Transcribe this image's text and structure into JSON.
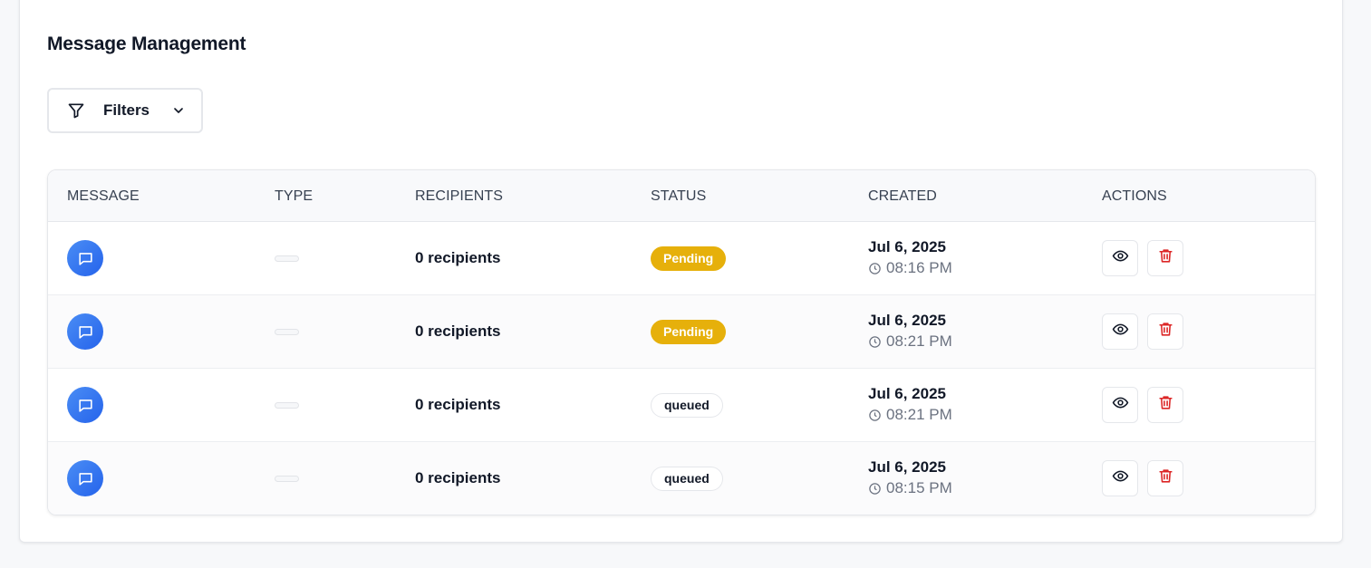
{
  "page": {
    "title": "Message Management"
  },
  "filters": {
    "label": "Filters"
  },
  "table": {
    "columns": [
      "MESSAGE",
      "TYPE",
      "RECIPIENTS",
      "STATUS",
      "CREATED",
      "ACTIONS"
    ],
    "rows": [
      {
        "recipients": "0 recipients",
        "status": "Pending",
        "status_kind": "pending",
        "date": "Jul 6, 2025",
        "time": "08:16 PM"
      },
      {
        "recipients": "0 recipients",
        "status": "Pending",
        "status_kind": "pending",
        "date": "Jul 6, 2025",
        "time": "08:21 PM"
      },
      {
        "recipients": "0 recipients",
        "status": "queued",
        "status_kind": "queued",
        "date": "Jul 6, 2025",
        "time": "08:21 PM"
      },
      {
        "recipients": "0 recipients",
        "status": "queued",
        "status_kind": "queued",
        "date": "Jul 6, 2025",
        "time": "08:15 PM"
      }
    ]
  },
  "icons": {
    "message": "message-square-icon",
    "filter": "filter-icon",
    "chevron": "chevron-down-icon",
    "clock": "clock-icon",
    "view": "eye-icon",
    "delete": "trash-icon"
  },
  "colors": {
    "accent": "#2563eb",
    "pending": "#e6b00b",
    "danger": "#dc2626"
  }
}
